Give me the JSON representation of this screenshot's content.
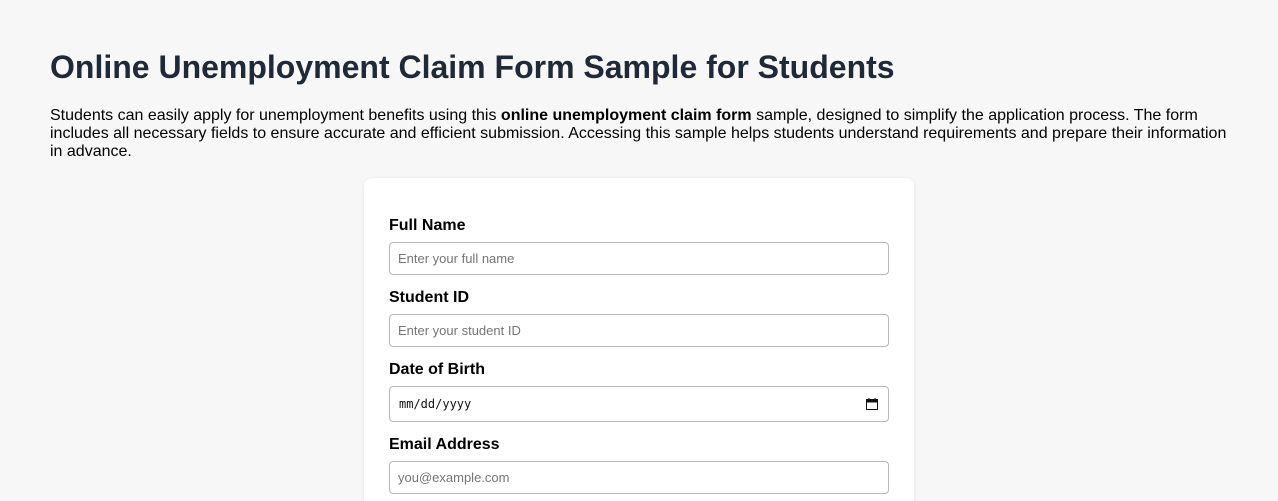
{
  "page": {
    "title": "Online Unemployment Claim Form Sample for Students",
    "intro_before": "Students can easily apply for unemployment benefits using this ",
    "intro_bold": "online unemployment claim form",
    "intro_after": " sample, designed to simplify the application process. The form includes all necessary fields to ensure accurate and efficient submission. Accessing this sample helps students understand requirements and prepare their information in advance."
  },
  "form": {
    "full_name": {
      "label": "Full Name",
      "placeholder": "Enter your full name",
      "value": ""
    },
    "student_id": {
      "label": "Student ID",
      "placeholder": "Enter your student ID",
      "value": ""
    },
    "dob": {
      "label": "Date of Birth",
      "value_display": "mm/dd/yyyy",
      "icon": "calendar-icon"
    },
    "email": {
      "label": "Email Address",
      "placeholder": "you@example.com",
      "value": ""
    }
  },
  "colors": {
    "background": "#f7f7f7",
    "title": "#1f2937",
    "card": "#ffffff",
    "input_border": "#b8b8b8"
  }
}
